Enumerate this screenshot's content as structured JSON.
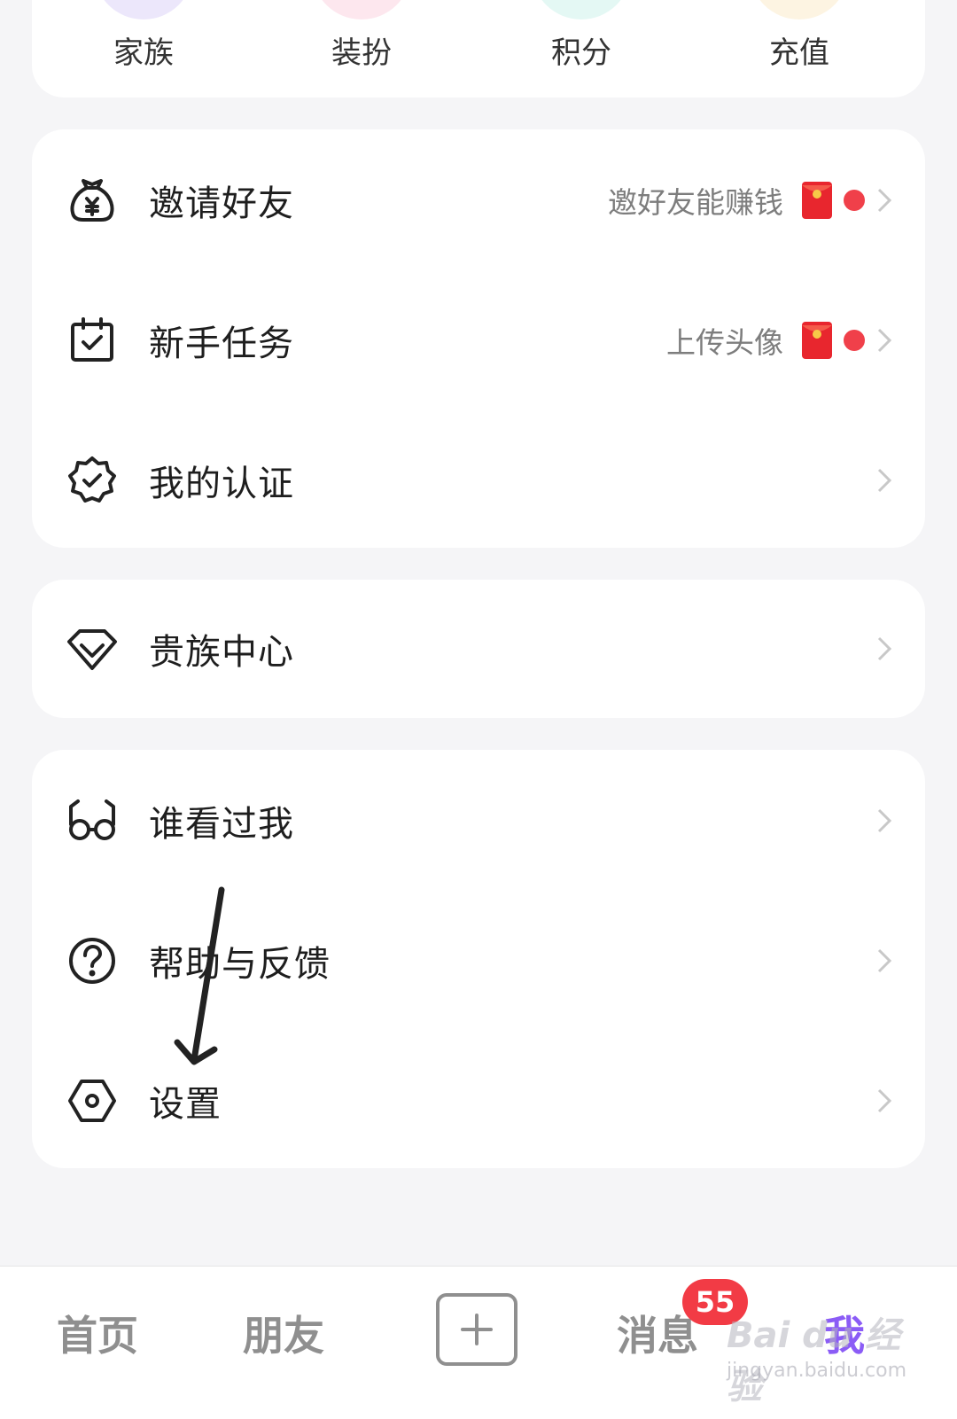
{
  "quick_actions": [
    {
      "label": "家族",
      "color": "#ece7fb"
    },
    {
      "label": "装扮",
      "color": "#fde7ee"
    },
    {
      "label": "积分",
      "color": "#e4f8f4"
    },
    {
      "label": "充值",
      "color": "#fdf4e2"
    }
  ],
  "group1": {
    "invite": {
      "label": "邀请好友",
      "hint": "邀好友能赚钱"
    },
    "tasks": {
      "label": "新手任务",
      "hint": "上传头像"
    },
    "cert": {
      "label": "我的认证"
    }
  },
  "group2": {
    "noble": {
      "label": "贵族中心"
    }
  },
  "group3": {
    "visitors": {
      "label": "谁看过我"
    },
    "help": {
      "label": "帮助与反馈"
    },
    "settings": {
      "label": "设置"
    }
  },
  "bottom_nav": {
    "home": "首页",
    "friends": "朋友",
    "messages": "消息",
    "messages_badge": "55",
    "me": "我"
  },
  "watermark": {
    "text": "Bai du 经验",
    "sub": "jingyan.baidu.com"
  },
  "colors": {
    "accent_red": "#f0404a",
    "badge_red": "#f23b45",
    "me_purple": "#8b5cf6"
  }
}
